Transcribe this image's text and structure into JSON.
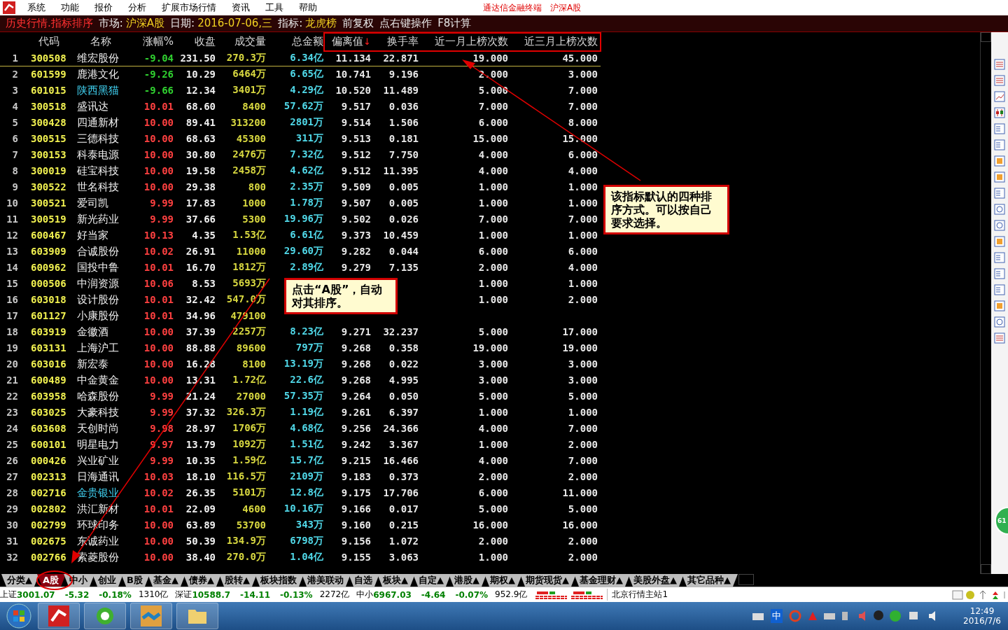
{
  "menu_bar": {
    "items": [
      "系统",
      "功能",
      "报价",
      "分析",
      "扩展市场行情",
      "资讯",
      "工具",
      "帮助"
    ],
    "right_items": [
      "通达信金融终端",
      "沪深A股"
    ]
  },
  "title_bar": {
    "view": "历史行情.指标排序",
    "fields": [
      {
        "label": "市场:",
        "value": "沪深A股"
      },
      {
        "label": "日期:",
        "value": "2016-07-06,三"
      },
      {
        "label": "指标:",
        "value": "龙虎榜"
      }
    ],
    "extras": [
      "前复权",
      "点右键操作",
      "F8计算"
    ]
  },
  "table": {
    "columns": [
      {},
      {
        "label": "代码"
      },
      {
        "label": "名称"
      },
      {
        "label": "涨幅%"
      },
      {
        "label": "收盘"
      },
      {
        "label": "成交量"
      },
      {
        "label": "总金额"
      },
      {
        "label": "偏离值",
        "sort_indicator": "↓"
      },
      {
        "label": "换手率"
      },
      {
        "label": "近一月上榜次数"
      },
      {
        "label": "近三月上榜次数"
      }
    ],
    "rows": [
      {
        "cells": [
          "1",
          "300508",
          "维宏股份",
          "-9.04",
          "231.50",
          "270.3万",
          "6.34亿",
          "11.134",
          "22.871",
          "19.000",
          "45.000"
        ],
        "rising": false,
        "highlighted": false,
        "selected": true
      },
      {
        "cells": [
          "2",
          "601599",
          "鹿港文化",
          "-9.26",
          "10.29",
          "6464万",
          "6.65亿",
          "10.741",
          "9.196",
          "2.000",
          "3.000"
        ],
        "rising": false,
        "highlighted": false,
        "selected": false
      },
      {
        "cells": [
          "3",
          "601015",
          "陕西黑猫",
          "-9.66",
          "12.34",
          "3401万",
          "4.29亿",
          "10.520",
          "11.489",
          "5.000",
          "7.000"
        ],
        "rising": false,
        "highlighted": true,
        "selected": false
      },
      {
        "cells": [
          "4",
          "300518",
          "盛讯达",
          "10.01",
          "68.60",
          "8400",
          "57.62万",
          "9.517",
          "0.036",
          "7.000",
          "7.000"
        ],
        "rising": true,
        "highlighted": false,
        "selected": false
      },
      {
        "cells": [
          "5",
          "300428",
          "四通新材",
          "10.00",
          "89.41",
          "313200",
          "2801万",
          "9.514",
          "1.506",
          "6.000",
          "8.000"
        ],
        "rising": true,
        "highlighted": false,
        "selected": false
      },
      {
        "cells": [
          "6",
          "300515",
          "三德科技",
          "10.00",
          "68.63",
          "45300",
          "311万",
          "9.513",
          "0.181",
          "15.000",
          "15.000"
        ],
        "rising": true,
        "highlighted": false,
        "selected": false
      },
      {
        "cells": [
          "7",
          "300153",
          "科泰电源",
          "10.00",
          "30.80",
          "2476万",
          "7.32亿",
          "9.512",
          "7.750",
          "4.000",
          "6.000"
        ],
        "rising": true,
        "highlighted": false,
        "selected": false
      },
      {
        "cells": [
          "8",
          "300019",
          "硅宝科技",
          "10.00",
          "19.58",
          "2458万",
          "4.62亿",
          "9.512",
          "11.395",
          "4.000",
          "4.000"
        ],
        "rising": true,
        "highlighted": false,
        "selected": false
      },
      {
        "cells": [
          "9",
          "300522",
          "世名科技",
          "10.00",
          "29.38",
          "800",
          "2.35万",
          "9.509",
          "0.005",
          "1.000",
          "1.000"
        ],
        "rising": true,
        "highlighted": false,
        "selected": false
      },
      {
        "cells": [
          "10",
          "300521",
          "爱司凯",
          "9.99",
          "17.83",
          "1000",
          "1.78万",
          "9.507",
          "0.005",
          "1.000",
          "1.000"
        ],
        "rising": true,
        "highlighted": false,
        "selected": false
      },
      {
        "cells": [
          "11",
          "300519",
          "新光药业",
          "9.99",
          "37.66",
          "5300",
          "19.96万",
          "9.502",
          "0.026",
          "7.000",
          "7.000"
        ],
        "rising": true,
        "highlighted": false,
        "selected": false
      },
      {
        "cells": [
          "12",
          "600467",
          "好当家",
          "10.13",
          "4.35",
          "1.53亿",
          "6.61亿",
          "9.373",
          "10.459",
          "1.000",
          "1.000"
        ],
        "rising": true,
        "highlighted": false,
        "selected": false
      },
      {
        "cells": [
          "13",
          "603909",
          "合诚股份",
          "10.02",
          "26.91",
          "11000",
          "29.60万",
          "9.282",
          "0.044",
          "6.000",
          "6.000"
        ],
        "rising": true,
        "highlighted": false,
        "selected": false
      },
      {
        "cells": [
          "14",
          "600962",
          "国投中鲁",
          "10.01",
          "16.70",
          "1812万",
          "2.89亿",
          "9.279",
          "7.135",
          "2.000",
          "4.000"
        ],
        "rising": true,
        "highlighted": false,
        "selected": false
      },
      {
        "cells": [
          "15",
          "000506",
          "中润资源",
          "10.06",
          "8.53",
          "5693万",
          null,
          null,
          null,
          "1.000",
          "1.000"
        ],
        "rising": true,
        "highlighted": false,
        "selected": false
      },
      {
        "cells": [
          "16",
          "603018",
          "设计股份",
          "10.01",
          "32.42",
          "547.0万",
          null,
          null,
          null,
          "1.000",
          "2.000"
        ],
        "rising": true,
        "highlighted": false,
        "selected": false
      },
      {
        "cells": [
          "17",
          "601127",
          "小康股份",
          "10.01",
          "34.96",
          "479100",
          null,
          null,
          null,
          null,
          null
        ],
        "rising": true,
        "highlighted": false,
        "selected": false
      },
      {
        "cells": [
          "18",
          "603919",
          "金徽酒",
          "10.00",
          "37.39",
          "2257万",
          "8.23亿",
          "9.271",
          "32.237",
          "5.000",
          "17.000"
        ],
        "rising": true,
        "highlighted": false,
        "selected": false
      },
      {
        "cells": [
          "19",
          "603131",
          "上海沪工",
          "10.00",
          "88.88",
          "89600",
          "797万",
          "9.268",
          "0.358",
          "19.000",
          "19.000"
        ],
        "rising": true,
        "highlighted": false,
        "selected": false
      },
      {
        "cells": [
          "20",
          "603016",
          "新宏泰",
          "10.00",
          "16.28",
          "8100",
          "13.19万",
          "9.268",
          "0.022",
          "3.000",
          "3.000"
        ],
        "rising": true,
        "highlighted": false,
        "selected": false
      },
      {
        "cells": [
          "21",
          "600489",
          "中金黄金",
          "10.00",
          "13.31",
          "1.72亿",
          "22.6亿",
          "9.268",
          "4.995",
          "3.000",
          "3.000"
        ],
        "rising": true,
        "highlighted": false,
        "selected": false
      },
      {
        "cells": [
          "22",
          "603958",
          "哈森股份",
          "9.99",
          "21.24",
          "27000",
          "57.35万",
          "9.264",
          "0.050",
          "5.000",
          "5.000"
        ],
        "rising": true,
        "highlighted": false,
        "selected": false
      },
      {
        "cells": [
          "23",
          "603025",
          "大豪科技",
          "9.99",
          "37.32",
          "326.3万",
          "1.19亿",
          "9.261",
          "6.397",
          "1.000",
          "1.000"
        ],
        "rising": true,
        "highlighted": false,
        "selected": false
      },
      {
        "cells": [
          "24",
          "603608",
          "天创时尚",
          "9.98",
          "28.97",
          "1706万",
          "4.68亿",
          "9.256",
          "24.366",
          "4.000",
          "7.000"
        ],
        "rising": true,
        "highlighted": false,
        "selected": false
      },
      {
        "cells": [
          "25",
          "600101",
          "明星电力",
          "9.97",
          "13.79",
          "1092万",
          "1.51亿",
          "9.242",
          "3.367",
          "1.000",
          "2.000"
        ],
        "rising": true,
        "highlighted": false,
        "selected": false
      },
      {
        "cells": [
          "26",
          "000426",
          "兴业矿业",
          "9.99",
          "10.35",
          "1.59亿",
          "15.7亿",
          "9.215",
          "16.466",
          "4.000",
          "7.000"
        ],
        "rising": true,
        "highlighted": false,
        "selected": false
      },
      {
        "cells": [
          "27",
          "002313",
          "日海通讯",
          "10.03",
          "18.10",
          "116.5万",
          "2109万",
          "9.183",
          "0.373",
          "2.000",
          "2.000"
        ],
        "rising": true,
        "highlighted": false,
        "selected": false
      },
      {
        "cells": [
          "28",
          "002716",
          "金贵银业",
          "10.02",
          "26.35",
          "5101万",
          "12.8亿",
          "9.175",
          "17.706",
          "6.000",
          "11.000"
        ],
        "rising": true,
        "highlighted": true,
        "selected": false
      },
      {
        "cells": [
          "29",
          "002802",
          "洪汇新材",
          "10.01",
          "22.09",
          "4600",
          "10.16万",
          "9.166",
          "0.017",
          "5.000",
          "5.000"
        ],
        "rising": true,
        "highlighted": false,
        "selected": false
      },
      {
        "cells": [
          "30",
          "002799",
          "环球印务",
          "10.00",
          "63.89",
          "53700",
          "343万",
          "9.160",
          "0.215",
          "16.000",
          "16.000"
        ],
        "rising": true,
        "highlighted": false,
        "selected": false
      },
      {
        "cells": [
          "31",
          "002675",
          "东诚药业",
          "10.00",
          "50.39",
          "134.9万",
          "6798万",
          "9.156",
          "1.072",
          "2.000",
          "2.000"
        ],
        "rising": true,
        "highlighted": false,
        "selected": false
      },
      {
        "cells": [
          "32",
          "002766",
          "索菱股份",
          "10.00",
          "38.40",
          "270.0万",
          "1.04亿",
          "9.155",
          "3.063",
          "1.000",
          "2.000"
        ],
        "rising": true,
        "highlighted": false,
        "selected": false
      }
    ]
  },
  "callouts": [
    {
      "text": "该指标默认的四种排序方式。可以按自己要求选择。"
    },
    {
      "text": "点击“A股”，自动对其排序。"
    }
  ],
  "floating_badge": "61",
  "tabs": [
    {
      "label": "分类▲",
      "selected": false
    },
    {
      "label": "A股",
      "selected": true
    },
    {
      "label": "中小",
      "selected": false
    },
    {
      "label": "创业",
      "selected": false
    },
    {
      "label": "B股",
      "selected": false
    },
    {
      "label": "基金▲",
      "selected": false
    },
    {
      "label": "债券▲",
      "selected": false
    },
    {
      "label": "股转▲",
      "selected": false
    },
    {
      "label": "板块指数",
      "selected": false
    },
    {
      "label": "港美联动",
      "selected": false
    },
    {
      "label": "自选",
      "selected": false
    },
    {
      "label": "板块▲",
      "selected": false
    },
    {
      "label": "自定▲",
      "selected": false
    },
    {
      "label": "港股▲",
      "selected": false
    },
    {
      "label": "期权▲",
      "selected": false
    },
    {
      "label": "期货现货▲",
      "selected": false
    },
    {
      "label": "基金理财▲",
      "selected": false
    },
    {
      "label": "美股外盘▲",
      "selected": false
    },
    {
      "label": "其它品种▲",
      "selected": false
    }
  ],
  "status_bar": {
    "indices": [
      {
        "name": "上证",
        "value": "3001.07",
        "change": "-5.32",
        "percent": "-0.18%",
        "amount": "1310亿",
        "rising": false
      },
      {
        "name": "深证",
        "value": "10588.7",
        "change": "-14.11",
        "percent": "-0.13%",
        "amount": "2272亿",
        "rising": false
      },
      {
        "name": "中小",
        "value": "6967.03",
        "change": "-4.64",
        "percent": "-0.07%",
        "amount": "952.9亿",
        "rising": false
      }
    ],
    "server": "北京行情主站1"
  },
  "taskbar": {
    "ime": "中",
    "clock_time": "12:49",
    "clock_date": "2016/7/6"
  }
}
